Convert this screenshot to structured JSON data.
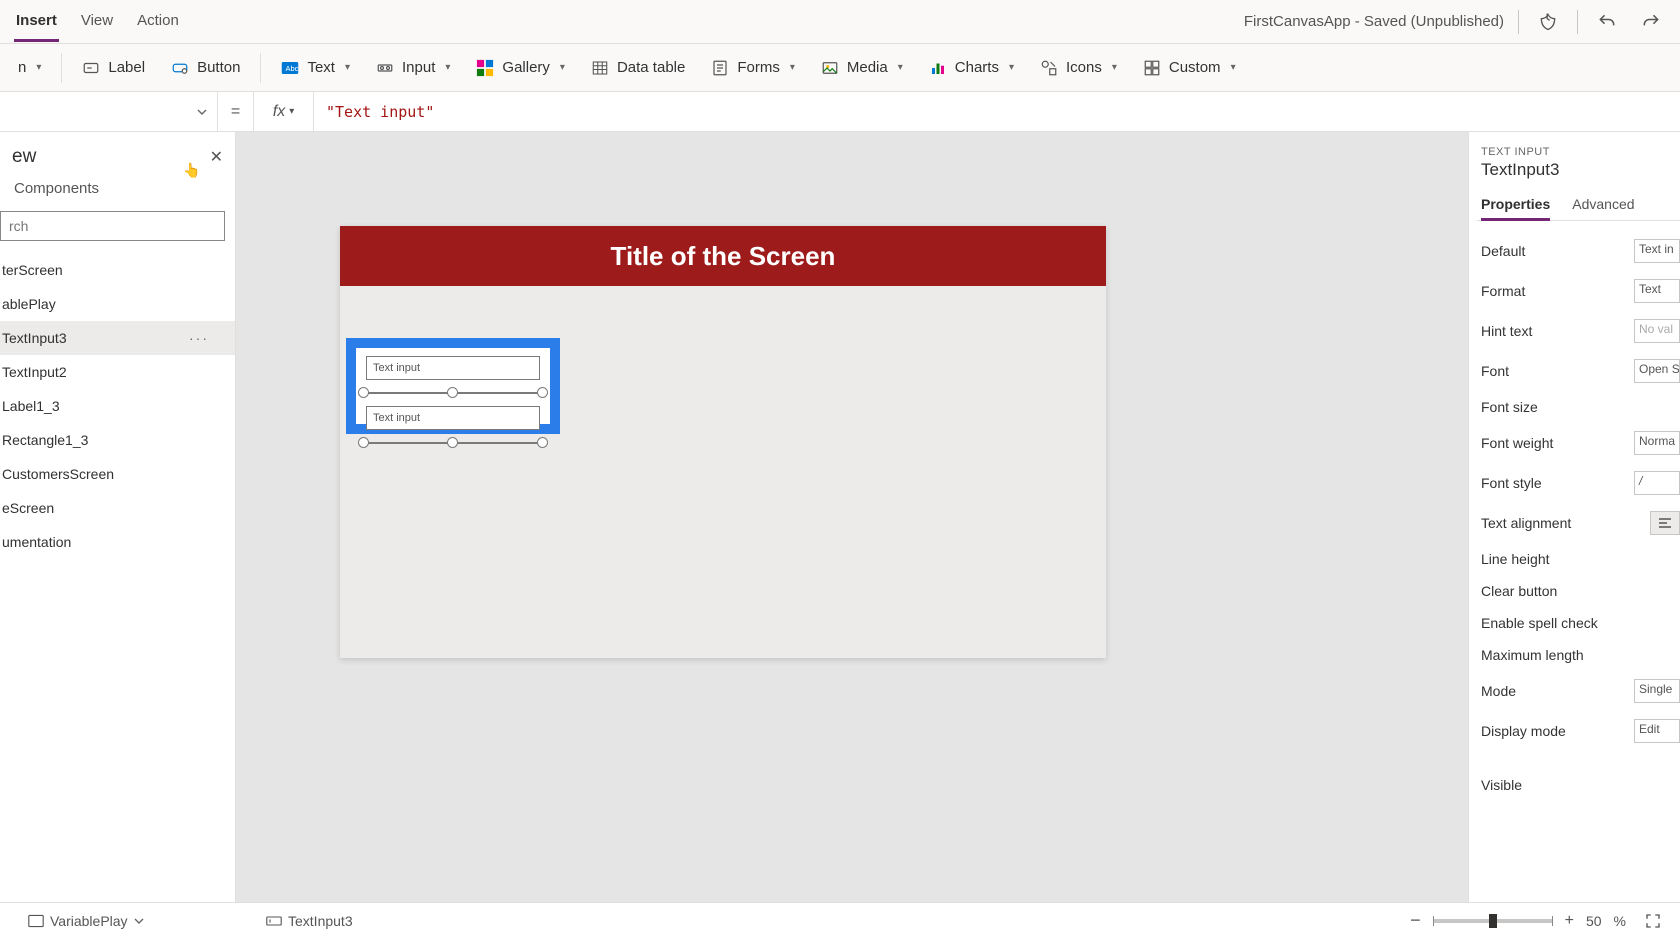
{
  "menubar": {
    "tabs": {
      "insert": "Insert",
      "view": "View",
      "action": "Action"
    },
    "app_title": "FirstCanvasApp - Saved (Unpublished)"
  },
  "ribbon": {
    "new_screen_chev": "n",
    "label": "Label",
    "button": "Button",
    "text": "Text",
    "input": "Input",
    "gallery": "Gallery",
    "data_table": "Data table",
    "forms": "Forms",
    "media": "Media",
    "charts": "Charts",
    "icons": "Icons",
    "custom": "Custom"
  },
  "formula": {
    "eq": "=",
    "fx": "fx",
    "value": "\"Text input\""
  },
  "tree": {
    "title": "ew",
    "tab_components": "Components",
    "search_placeholder": "rch",
    "items": [
      "terScreen",
      "ablePlay",
      "TextInput3",
      "TextInput2",
      "Label1_3",
      "Rectangle1_3",
      "CustomersScreen",
      "eScreen",
      "umentation"
    ],
    "selected_index": 2,
    "more": "···"
  },
  "canvas": {
    "screen_title": "Title of the Screen",
    "textinput_value_1": "Text input",
    "textinput_value_2": "Text input"
  },
  "props": {
    "control_type": "TEXT INPUT",
    "control_name": "TextInput3",
    "tab_props": "Properties",
    "tab_adv": "Advanced",
    "rows": {
      "default_l": "Default",
      "default_v": "Text in",
      "format_l": "Format",
      "format_v": "Text",
      "hint_l": "Hint text",
      "hint_v": "No val",
      "font_l": "Font",
      "font_v": "Open S",
      "fontsize_l": "Font size",
      "fontweight_l": "Font weight",
      "fontweight_v": "Norma",
      "fontstyle_l": "Font style",
      "fontstyle_v": "/",
      "align_l": "Text alignment",
      "lineh_l": "Line height",
      "clear_l": "Clear button",
      "spell_l": "Enable spell check",
      "maxlen_l": "Maximum length",
      "mode_l": "Mode",
      "mode_v": "Single",
      "dispmode_l": "Display mode",
      "dispmode_v": "Edit",
      "visible_l": "Visible"
    }
  },
  "status": {
    "crumb1": "VariablePlay",
    "crumb2": "TextInput3",
    "zoom_minus": "−",
    "zoom_plus": "+",
    "zoom_value": "50",
    "zoom_pct": "%"
  }
}
